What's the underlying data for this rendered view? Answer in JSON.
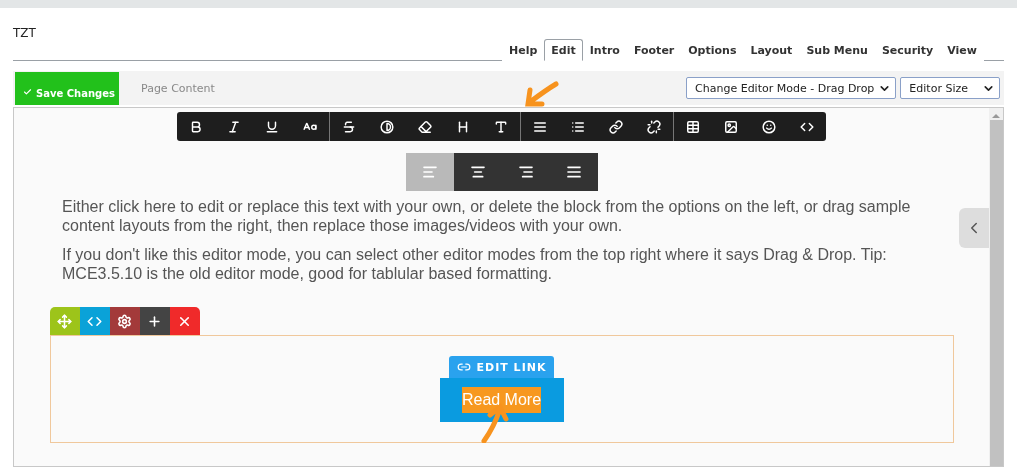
{
  "header": {
    "title": "TZT",
    "tabs": [
      {
        "label": "Help",
        "selected": false
      },
      {
        "label": "Edit",
        "selected": true
      },
      {
        "label": "Intro",
        "selected": false
      },
      {
        "label": "Footer",
        "selected": false
      },
      {
        "label": "Options",
        "selected": false
      },
      {
        "label": "Layout",
        "selected": false
      },
      {
        "label": "Sub Menu",
        "selected": false
      },
      {
        "label": "Security",
        "selected": false
      },
      {
        "label": "View",
        "selected": false
      }
    ]
  },
  "actions": {
    "save_label": "Save Changes",
    "section_label": "Page Content",
    "mode_select": "Change Editor Mode - Drag Drop",
    "size_select": "Editor Size"
  },
  "alignment": [
    {
      "selected": true
    },
    {
      "selected": false
    },
    {
      "selected": false
    },
    {
      "selected": false
    }
  ],
  "content": {
    "paragraphs": [
      "Either click here to edit or replace this text with your own, or delete the block from the options on the left, or drag sample content layouts from the right, then replace those images/videos with your own.",
      "If you don't like this editor mode, you can select other editor modes from the top right where it says Drag & Drop. Tip: MCE3.5.10 is the old editor mode, good for tablular based formatting."
    ],
    "link_tooltip": "EDIT LINK",
    "button_label": "Read More",
    "button_text_selected": true
  }
}
